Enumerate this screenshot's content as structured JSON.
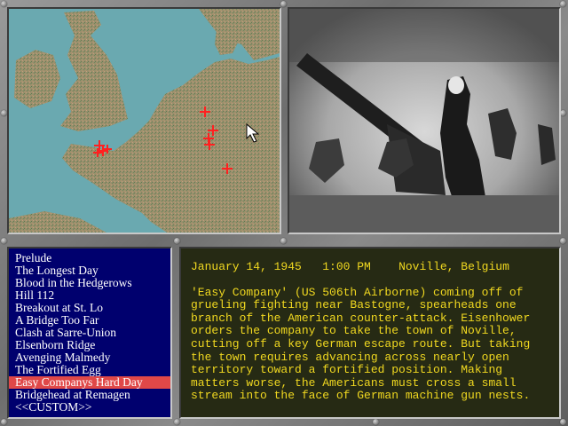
{
  "scenario_list": {
    "items": [
      "Prelude",
      "The Longest Day",
      "Blood in the Hedgerows",
      "Hill 112",
      "Breakout at St. Lo",
      "A Bridge Too Far",
      "Clash at Sarre-Union",
      "Elsenborn Ridge",
      "Avenging Malmedy",
      "The Fortified Egg",
      "Easy Companys Hard Day",
      "Bridgehead at Remagen",
      "<<CUSTOM>>"
    ],
    "selected_index": 10
  },
  "briefing": {
    "date": "January 14, 1945",
    "time": "1:00 PM",
    "location": "Noville, Belgium",
    "text": "'Easy Company' (US 506th Airborne) coming off of grueling fighting near Bastogne, spearheads one branch of the American counter-attack.  Eisenhower orders the company to take the town of Noville, cutting off a key German escape route.  But taking the town requires advancing across nearly open territory toward a fortified position.  Making matters worse, the Americans must cross a small stream into the face of German machine gun nests."
  },
  "map": {
    "marker_icon": "red-cross-marker",
    "sea_color": "#6aa9b0",
    "land_color": "#9a8f6e"
  },
  "colors": {
    "list_background": "#00006e",
    "selected_highlight": "#e04848",
    "briefing_text": "#f0d820",
    "briefing_background": "#262a14"
  }
}
